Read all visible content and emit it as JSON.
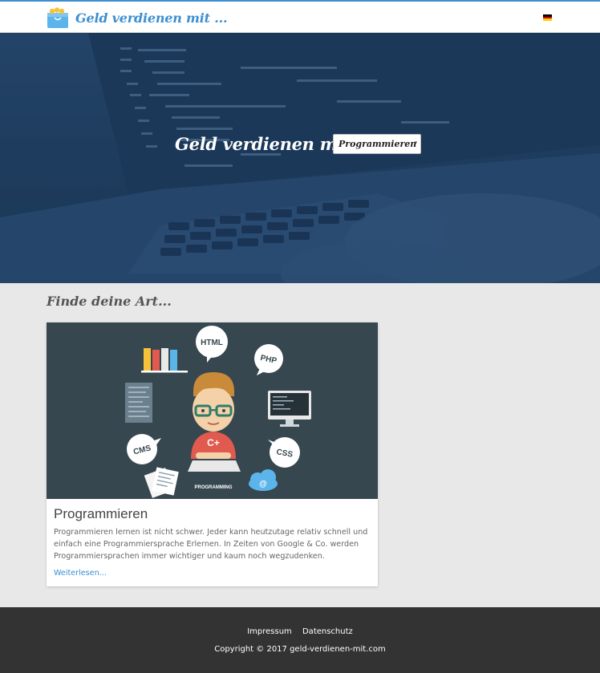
{
  "header": {
    "logo_text": "Geld verdienen mit ...",
    "language_icon": "german-flag-icon",
    "colors": {
      "accent": "#3b8fd1",
      "header_bg": "#ffffff"
    }
  },
  "hero": {
    "title": "Geld verdienen mit",
    "select_value": "Programmieren",
    "select_arrow": "▾",
    "background": "laptop-code-photo"
  },
  "section": {
    "title": "Finde deine Art..."
  },
  "card": {
    "image_labels": {
      "html": "HTML",
      "php": "PHP",
      "cms": "CMS",
      "css": "CSS",
      "shirt": "C+",
      "caption": "PROGRAMMING",
      "at": "@"
    },
    "title": "Programmieren",
    "text": "Programmieren lernen ist nicht schwer. Jeder kann heutzutage relativ schnell und einfach eine Programmiersprache Erlernen. In Zeiten von Google & Co. werden Programmiersprachen immer wichtiger und kaum noch wegzudenken.",
    "link": "Weiterlesen..."
  },
  "footer": {
    "links": [
      "Impressum",
      "Datenschutz"
    ],
    "copyright": "Copyright © 2017 geld-verdienen-mit.com",
    "colors": {
      "bg": "#333333"
    }
  }
}
